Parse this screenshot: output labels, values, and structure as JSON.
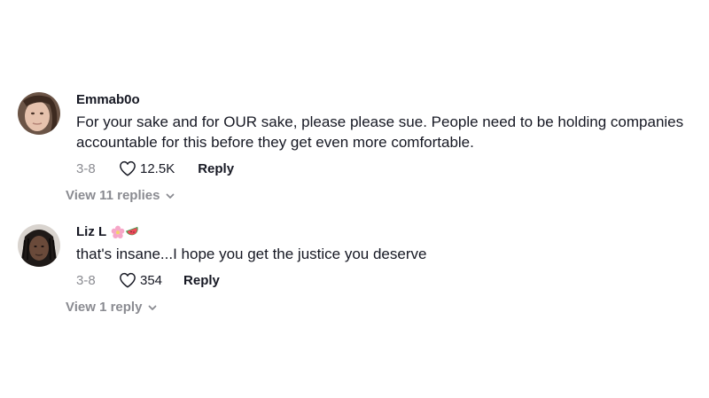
{
  "comments": [
    {
      "username": "Emmab0o",
      "text": "For your sake and for OUR sake, please please sue. People need to be holding companies accountable for this before they get even more comfortable.",
      "date": "3-8",
      "likes": "12.5K",
      "reply_label": "Reply",
      "view_replies_label": "View 11 replies"
    },
    {
      "username": "Liz L",
      "username_emojis": [
        "cherry-blossom-emoji",
        "watermelon-emoji"
      ],
      "text": "that's insane...I hope you get the justice you deserve",
      "date": "3-8",
      "likes": "354",
      "reply_label": "Reply",
      "view_replies_label": "View 1 reply"
    }
  ],
  "icons": {
    "like": "heart-outline-icon",
    "expand": "chevron-down-icon"
  },
  "colors": {
    "primary_text": "#161823",
    "secondary_text": "#8a8b91",
    "background": "#ffffff"
  }
}
